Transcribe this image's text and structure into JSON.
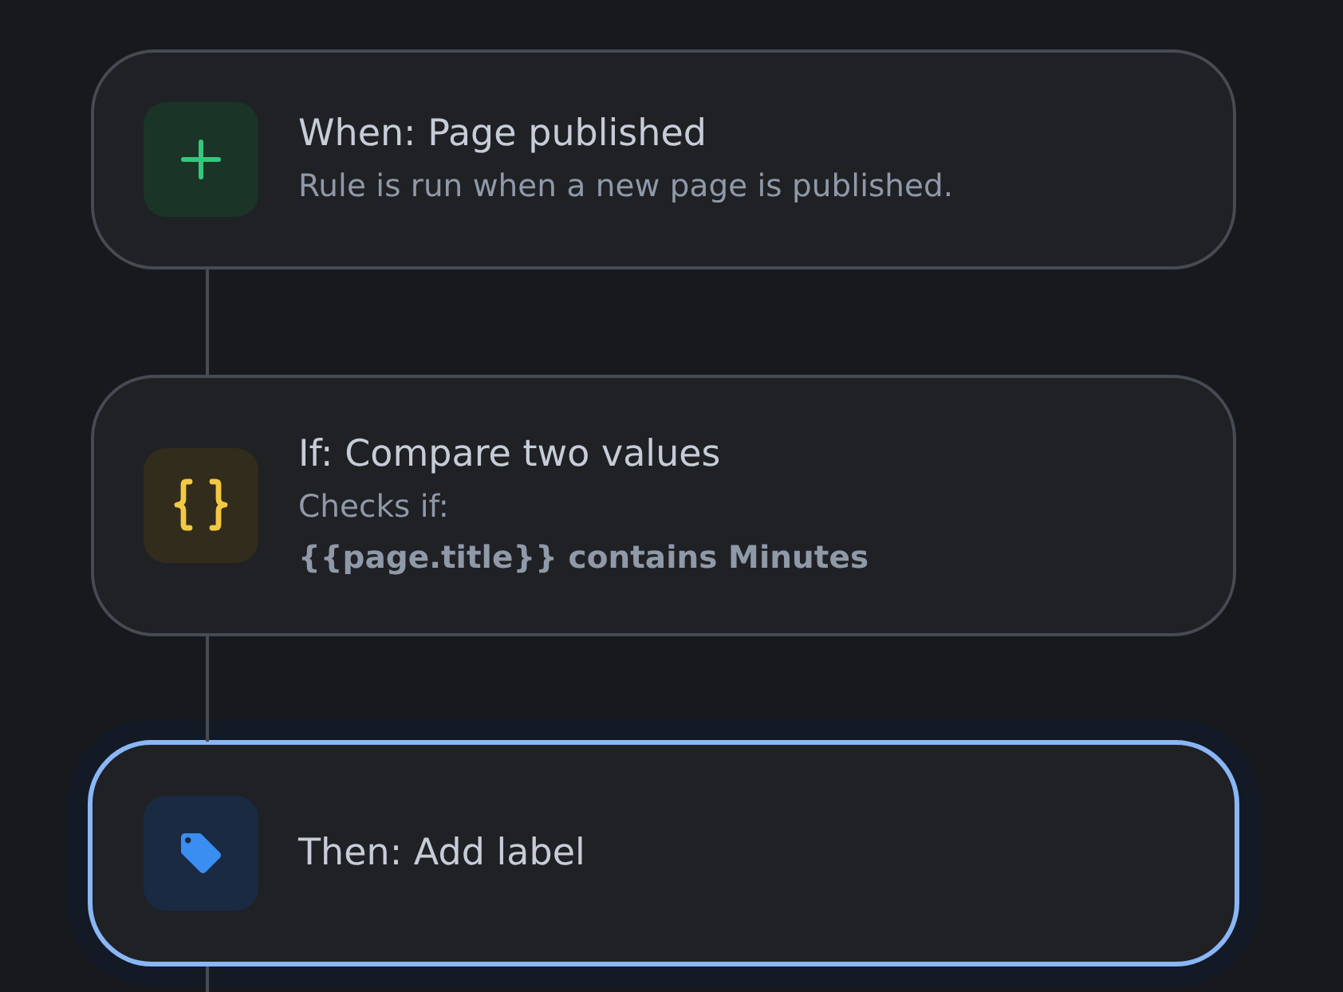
{
  "steps": [
    {
      "kind": "trigger",
      "title": "When: Page published",
      "description": "Rule is run when a new page is published.",
      "selected": false
    },
    {
      "kind": "condition",
      "title": "If: Compare two values",
      "description": "Checks if:",
      "detail": "{{page.title}} contains Minutes",
      "selected": false
    },
    {
      "kind": "action",
      "title": "Then: Add label",
      "selected": true
    }
  ]
}
